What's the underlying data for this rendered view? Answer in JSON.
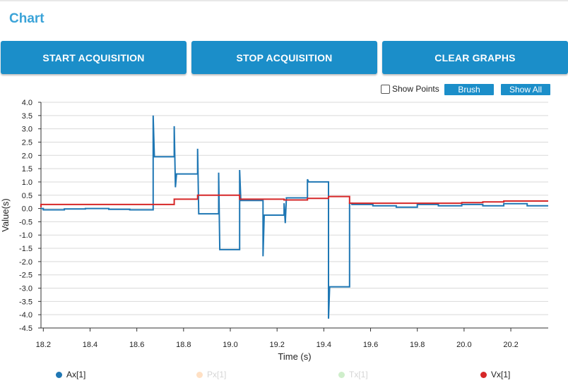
{
  "header": {
    "title": "Chart"
  },
  "toolbar": {
    "start_label": "START ACQUISITION",
    "stop_label": "STOP ACQUISITION",
    "clear_label": "CLEAR GRAPHS"
  },
  "controls": {
    "show_points_label": "Show Points",
    "show_points_checked": false,
    "brush_label": "Brush",
    "show_all_label": "Show All"
  },
  "colors": {
    "accent": "#1b8ec9",
    "title": "#3aa3d8",
    "ax": "#1f77b4",
    "vx": "#d62728",
    "px": "#ffbb78",
    "tx": "#98df8a"
  },
  "chart_data": {
    "type": "line",
    "xlabel": "Time (s)",
    "ylabel": "Value(s)",
    "xlim": [
      18.19,
      20.36
    ],
    "ylim": [
      -4.5,
      4.0
    ],
    "x_ticks": [
      "18.2",
      "18.4",
      "18.6",
      "18.8",
      "19.0",
      "19.2",
      "19.4",
      "19.6",
      "19.8",
      "20.0",
      "20.2"
    ],
    "y_ticks": [
      "4.0",
      "3.5",
      "3.0",
      "2.5",
      "2.0",
      "1.5",
      "1.0",
      "0.5",
      "0.0",
      "-0.5",
      "-1.0",
      "-1.5",
      "-2.0",
      "-2.5",
      "-3.0",
      "-3.5",
      "-4.0",
      "-4.5"
    ],
    "grid": "horizontal",
    "legend_position": "bottom",
    "series": [
      {
        "name": "Ax[1]",
        "color": "#1f77b4",
        "visible": true,
        "points": [
          [
            18.19,
            0.0
          ],
          [
            18.2,
            0.0
          ],
          [
            18.2,
            -0.05
          ],
          [
            18.29,
            -0.05
          ],
          [
            18.29,
            -0.02
          ],
          [
            18.38,
            -0.02
          ],
          [
            18.38,
            0.0
          ],
          [
            18.48,
            0.0
          ],
          [
            18.48,
            -0.03
          ],
          [
            18.57,
            -0.03
          ],
          [
            18.57,
            -0.05
          ],
          [
            18.67,
            -0.05
          ],
          [
            18.67,
            3.5
          ],
          [
            18.675,
            1.95
          ],
          [
            18.76,
            1.95
          ],
          [
            18.76,
            3.1
          ],
          [
            18.765,
            0.8
          ],
          [
            18.77,
            1.3
          ],
          [
            18.86,
            1.3
          ],
          [
            18.86,
            2.25
          ],
          [
            18.865,
            -0.2
          ],
          [
            18.95,
            -0.2
          ],
          [
            18.95,
            1.35
          ],
          [
            18.955,
            -1.55
          ],
          [
            19.04,
            -1.55
          ],
          [
            19.04,
            1.45
          ],
          [
            19.045,
            0.3
          ],
          [
            19.14,
            0.3
          ],
          [
            19.14,
            -1.8
          ],
          [
            19.145,
            -0.25
          ],
          [
            19.23,
            -0.25
          ],
          [
            19.23,
            0.2
          ],
          [
            19.235,
            -0.55
          ],
          [
            19.24,
            0.4
          ],
          [
            19.33,
            0.4
          ],
          [
            19.33,
            1.1
          ],
          [
            19.335,
            1.0
          ],
          [
            19.42,
            1.0
          ],
          [
            19.42,
            -4.15
          ],
          [
            19.425,
            -2.95
          ],
          [
            19.51,
            -2.95
          ],
          [
            19.51,
            0.2
          ],
          [
            19.52,
            0.2
          ],
          [
            19.52,
            0.15
          ],
          [
            19.61,
            0.15
          ],
          [
            19.61,
            0.1
          ],
          [
            19.71,
            0.1
          ],
          [
            19.71,
            0.05
          ],
          [
            19.8,
            0.05
          ],
          [
            19.8,
            0.15
          ],
          [
            19.89,
            0.15
          ],
          [
            19.89,
            0.1
          ],
          [
            19.99,
            0.1
          ],
          [
            19.99,
            0.15
          ],
          [
            20.08,
            0.15
          ],
          [
            20.08,
            0.1
          ],
          [
            20.17,
            0.1
          ],
          [
            20.17,
            0.18
          ],
          [
            20.27,
            0.18
          ],
          [
            20.27,
            0.1
          ],
          [
            20.36,
            0.1
          ]
        ]
      },
      {
        "name": "Px[1]",
        "color": "#ffbb78",
        "visible": false,
        "points": []
      },
      {
        "name": "Tx[1]",
        "color": "#98df8a",
        "visible": false,
        "points": []
      },
      {
        "name": "Vx[1]",
        "color": "#d62728",
        "visible": true,
        "points": [
          [
            18.19,
            0.05
          ],
          [
            18.19,
            0.15
          ],
          [
            18.29,
            0.15
          ],
          [
            18.29,
            0.15
          ],
          [
            18.67,
            0.15
          ],
          [
            18.67,
            0.15
          ],
          [
            18.76,
            0.15
          ],
          [
            18.76,
            0.35
          ],
          [
            18.86,
            0.35
          ],
          [
            18.86,
            0.5
          ],
          [
            19.04,
            0.5
          ],
          [
            19.04,
            0.35
          ],
          [
            19.14,
            0.35
          ],
          [
            19.14,
            0.35
          ],
          [
            19.23,
            0.35
          ],
          [
            19.23,
            0.32
          ],
          [
            19.33,
            0.32
          ],
          [
            19.33,
            0.38
          ],
          [
            19.42,
            0.38
          ],
          [
            19.42,
            0.45
          ],
          [
            19.51,
            0.45
          ],
          [
            19.51,
            0.2
          ],
          [
            19.61,
            0.2
          ],
          [
            19.61,
            0.2
          ],
          [
            19.99,
            0.2
          ],
          [
            19.99,
            0.22
          ],
          [
            20.08,
            0.22
          ],
          [
            20.08,
            0.25
          ],
          [
            20.17,
            0.25
          ],
          [
            20.17,
            0.28
          ],
          [
            20.36,
            0.28
          ]
        ]
      }
    ]
  }
}
